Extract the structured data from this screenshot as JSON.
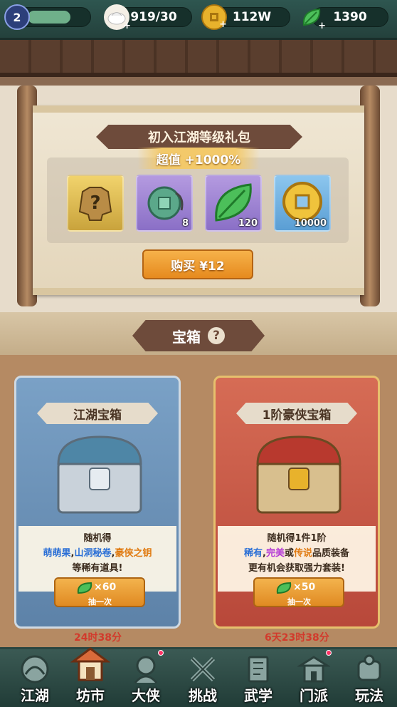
{
  "resources": {
    "level": "2",
    "stamina": "919/30",
    "coins": "112W",
    "leaves": "1390"
  },
  "gift_pack": {
    "title": "初入江湖等级礼包",
    "value_label": "超值 +1000%",
    "items": [
      {
        "name": "mystery-equipment",
        "count": ""
      },
      {
        "name": "jade-key",
        "count": "8"
      },
      {
        "name": "green-leaf",
        "count": "120"
      },
      {
        "name": "gold-coin",
        "count": "10000"
      }
    ],
    "buy_label": "购买 ¥12"
  },
  "chests_section": {
    "title": "宝箱",
    "help": "?"
  },
  "chests": [
    {
      "name": "江湖宝箱",
      "line1": "随机得",
      "line2_parts": [
        {
          "text": "萌萌果",
          "color": "#2a6fd6"
        },
        {
          "text": ",",
          "color": "#3a2a1c"
        },
        {
          "text": "山洞秘卷",
          "color": "#2a6fd6"
        },
        {
          "text": ",",
          "color": "#3a2a1c"
        },
        {
          "text": "豪侠之钥",
          "color": "#e07a10"
        }
      ],
      "line3": "等稀有道具!",
      "cost": "×60",
      "draw_label": "抽一次",
      "timer": "24时38分"
    },
    {
      "name": "1阶豪侠宝箱",
      "line1": "随机得1件1阶",
      "line2_parts": [
        {
          "text": "稀有",
          "color": "#2a6fd6"
        },
        {
          "text": ",",
          "color": "#3a2a1c"
        },
        {
          "text": "完美",
          "color": "#b43ad6"
        },
        {
          "text": "或",
          "color": "#3a2a1c"
        },
        {
          "text": "传说",
          "color": "#e07a10"
        },
        {
          "text": "品质装备",
          "color": "#3a2a1c"
        }
      ],
      "line3": "更有机会获取强力套装!",
      "cost": "×50",
      "draw_label": "抽一次",
      "timer": "6天23时38分"
    }
  ],
  "nav": [
    {
      "label": "江湖",
      "icon": "jianghu-icon",
      "active": false
    },
    {
      "label": "坊市",
      "icon": "market-icon",
      "active": true
    },
    {
      "label": "大侠",
      "icon": "hero-icon",
      "active": false
    },
    {
      "label": "挑战",
      "icon": "swords-icon",
      "active": false
    },
    {
      "label": "武学",
      "icon": "book-icon",
      "active": false
    },
    {
      "label": "门派",
      "icon": "sect-icon",
      "active": false
    },
    {
      "label": "玩法",
      "icon": "gameplay-icon",
      "active": false
    }
  ],
  "colors": {
    "accent_orange": "#e68a1e",
    "blue_card": "#5d82a8",
    "red_card": "#b8483a",
    "timer_red": "#d23a2c"
  }
}
